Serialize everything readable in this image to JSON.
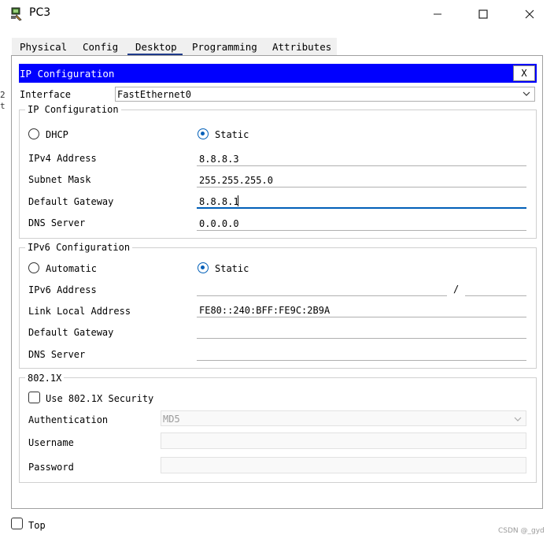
{
  "window": {
    "title": "PC3",
    "left_edge_chars": [
      "2",
      "t"
    ]
  },
  "tabs": [
    {
      "label": "Physical"
    },
    {
      "label": "Config"
    },
    {
      "label": "Desktop"
    },
    {
      "label": "Programming"
    },
    {
      "label": "Attributes"
    }
  ],
  "ip_config": {
    "title": "IP Configuration",
    "close_label": "X",
    "interface_label": "Interface",
    "interface_value": "FastEthernet0",
    "ipv4": {
      "group_title": "IP Configuration",
      "dhcp_label": "DHCP",
      "static_label": "Static",
      "ipv4_address_label": "IPv4 Address",
      "ipv4_address_value": "8.8.8.3",
      "subnet_mask_label": "Subnet Mask",
      "subnet_mask_value": "255.255.255.0",
      "default_gateway_label": "Default Gateway",
      "default_gateway_value": "8.8.8.1",
      "dns_server_label": "DNS Server",
      "dns_server_value": "0.0.0.0"
    },
    "ipv6": {
      "group_title": "IPv6 Configuration",
      "automatic_label": "Automatic",
      "static_label": "Static",
      "ipv6_address_label": "IPv6 Address",
      "ipv6_address_value": "",
      "prefix_separator": "/",
      "prefix_value": "",
      "link_local_label": "Link Local Address",
      "link_local_value": "FE80::240:BFF:FE9C:2B9A",
      "default_gateway_label": "Default Gateway",
      "default_gateway_value": "",
      "dns_server_label": "DNS Server",
      "dns_server_value": ""
    },
    "dot1x": {
      "group_title": "802.1X",
      "use_security_label": "Use 802.1X Security",
      "authentication_label": "Authentication",
      "authentication_value": "MD5",
      "username_label": "Username",
      "password_label": "Password"
    }
  },
  "footer": {
    "top_label": "Top",
    "watermark": "CSDN @_gyd"
  }
}
